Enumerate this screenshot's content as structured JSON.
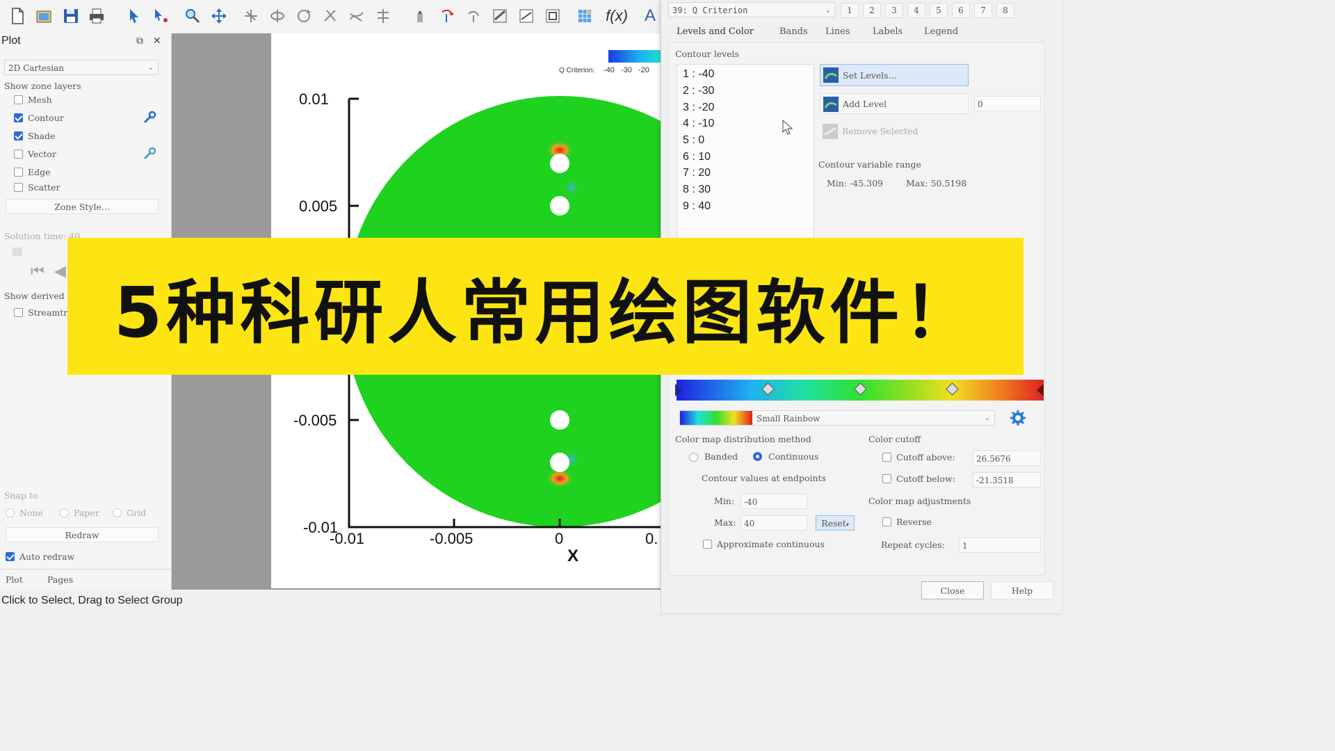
{
  "toolbar": {
    "icons": [
      "new-file-icon",
      "open-icon",
      "save-icon",
      "print-icon",
      "select-arrow-icon",
      "adjust-icon",
      "zoom-icon",
      "translate-icon",
      "probe-icon",
      "rotate-icon",
      "rotate-3d-icon",
      "slice-icon",
      "streamtrace-icon",
      "contour-add-icon",
      "point-icon",
      "pan-icon",
      "undo-rotate-icon",
      "redo-rotate-icon",
      "draw-line-icon",
      "draw-poly-icon",
      "draw-grid-icon",
      "frame-icon",
      "function-icon",
      "text-icon"
    ],
    "fx_label": "f(x)",
    "text_label": "A"
  },
  "left_panel": {
    "title": "Plot",
    "plot_type": "2D Cartesian",
    "zone_layers_label": "Show zone layers",
    "layers": [
      {
        "label": "Mesh",
        "checked": false
      },
      {
        "label": "Contour",
        "checked": true
      },
      {
        "label": "Shade",
        "checked": true
      },
      {
        "label": "Vector",
        "checked": false
      },
      {
        "label": "Edge",
        "checked": false
      },
      {
        "label": "Scatter",
        "checked": false
      }
    ],
    "zone_style_button": "Zone Style...",
    "solution_time_label": "Solution time: 40",
    "show_derived_label": "Show derived",
    "streamtraces_label": "Streamtr",
    "snap_to_label": "Snap to",
    "snap_options": [
      "None",
      "Paper",
      "Grid"
    ],
    "redraw_button": "Redraw",
    "auto_redraw_label": "Auto redraw",
    "bottom_tabs": [
      "Plot",
      "Pages"
    ]
  },
  "plot": {
    "y_ticks": [
      "0.01",
      "0.005",
      "-0.005",
      "-0.01"
    ],
    "x_ticks": [
      "-0.01",
      "-0.005",
      "0",
      "0."
    ],
    "x_label": "X",
    "legend_title": "Q Criterion:",
    "legend_values": [
      "-40",
      "-30",
      "-20"
    ]
  },
  "dialog": {
    "variable": "39: Q Criterion",
    "number_tabs": [
      "1",
      "2",
      "3",
      "4",
      "5",
      "6",
      "7",
      "8"
    ],
    "tabs": [
      "Levels and Color",
      "Bands",
      "Lines",
      "Labels",
      "Legend"
    ],
    "contour_levels_label": "Contour levels",
    "levels": [
      "1 : -40",
      "2 : -30",
      "3 : -20",
      "4 : -10",
      "5 : 0",
      "6 : 10",
      "7 : 20",
      "8 : 30",
      "9 : 40"
    ],
    "set_levels_button": "Set Levels...",
    "add_level_button": "Add Level",
    "add_level_value": "0",
    "remove_selected_button": "Remove Selected",
    "range_label": "Contour variable range",
    "range_min": "Min: -45.309",
    "range_max": "Max: 50.5198",
    "colormap_name": "Small Rainbow",
    "dist_method_label": "Color map distribution method",
    "banded_label": "Banded",
    "continuous_label": "Continuous",
    "endpoints_label": "Contour values at endpoints",
    "min_label": "Min:",
    "min_value": "-40",
    "max_label": "Max:",
    "max_value": "40",
    "reset_button": "Reset",
    "approx_label": "Approximate continuous",
    "cutoff_label": "Color cutoff",
    "cutoff_above_label": "Cutoff above:",
    "cutoff_above_value": "26.5676",
    "cutoff_below_label": "Cutoff below:",
    "cutoff_below_value": "-21.3518",
    "adjust_label": "Color map adjustments",
    "reverse_label": "Reverse",
    "repeat_label": "Repeat cycles:",
    "repeat_value": "1",
    "close_button": "Close",
    "help_button": "Help"
  },
  "status_text": "Click to Select, Drag to Select Group",
  "banner_text": "5种科研人常用绘图软件！",
  "colors": {
    "banner": "#fde513",
    "contour_green": "#1fd21f",
    "accent": "#2c6bd6"
  }
}
